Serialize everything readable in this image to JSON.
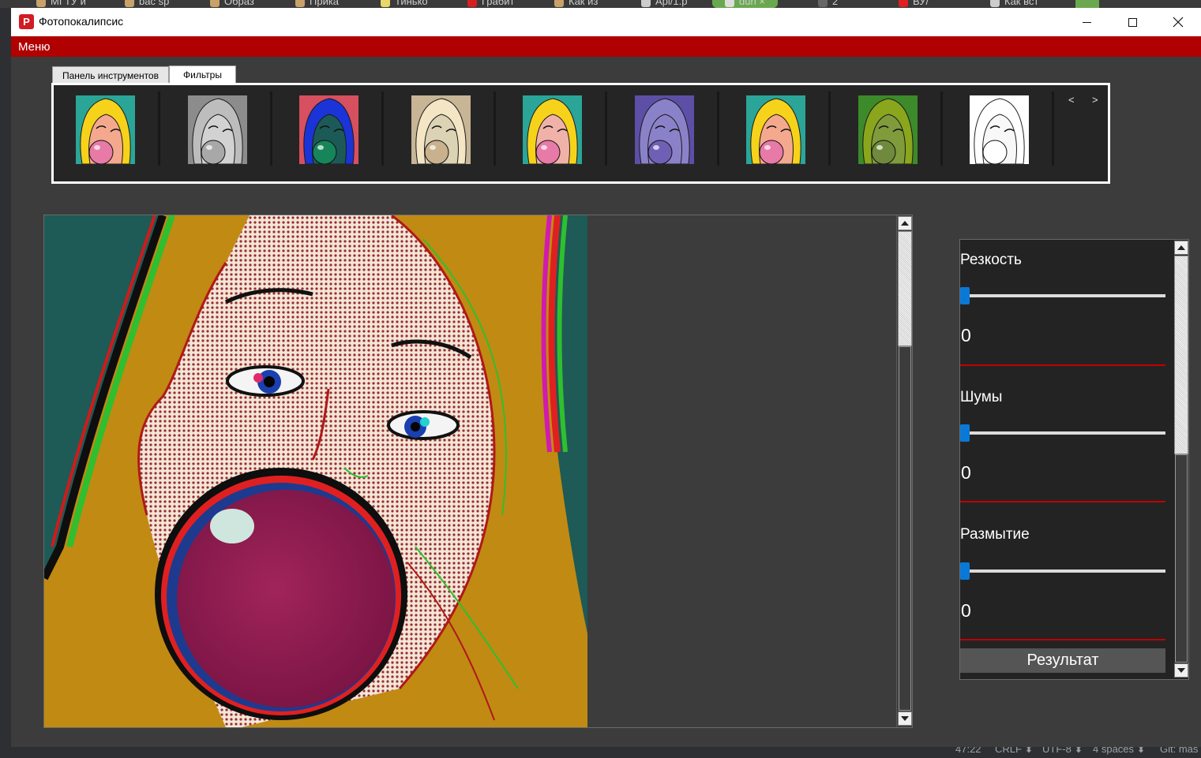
{
  "window": {
    "title": "Фотопокалипсис",
    "icon_letter": "P"
  },
  "menu": {
    "items": [
      {
        "label": "Меню"
      }
    ]
  },
  "tabs": [
    {
      "label": "Панель инструментов",
      "active": false
    },
    {
      "label": "Фильтры",
      "active": true
    }
  ],
  "filters": {
    "items": [
      {
        "name": "original",
        "skin": "#f4a98e",
        "hair": "#f7d21a",
        "bg": "#2aa598",
        "gum": "#e87aa7"
      },
      {
        "name": "grayscale",
        "skin": "#d2d2d2",
        "hair": "#bdbdbd",
        "bg": "#8c8c8c",
        "gum": "#a8a8a8"
      },
      {
        "name": "inverted",
        "skin": "#1c5a57",
        "hair": "#1a34d8",
        "bg": "#d6505f",
        "gum": "#17855a"
      },
      {
        "name": "sepia",
        "skin": "#dcd2b4",
        "hair": "#f4e5c4",
        "bg": "#c7b596",
        "gum": "#c9b18e"
      },
      {
        "name": "halftone",
        "skin": "#f0b2a8",
        "hair": "#f7d21a",
        "bg": "#2aa598",
        "gum": "#e87aa7"
      },
      {
        "name": "purple",
        "skin": "#8a82c9",
        "hair": "#8a82c9",
        "bg": "#5d4fa6",
        "gum": "#6f5fb5"
      },
      {
        "name": "channel-shift",
        "skin": "#f4a98e",
        "hair": "#f7d21a",
        "bg": "#2aa598",
        "gum": "#e87aa7"
      },
      {
        "name": "green-tint",
        "skin": "#7f9b3c",
        "hair": "#8aa61c",
        "bg": "#3c8a2a",
        "gum": "#6f8a3c"
      },
      {
        "name": "sketch",
        "skin": "#f8f8f8",
        "hair": "#ffffff",
        "bg": "#ffffff",
        "gum": "#ffffff"
      }
    ],
    "prev_label": "<",
    "next_label": ">"
  },
  "settings": {
    "sharpness": {
      "label": "Резкость",
      "value": "0"
    },
    "noise": {
      "label": "Шумы",
      "value": "0"
    },
    "blur": {
      "label": "Размытие",
      "value": "0"
    },
    "result_label": "Результат"
  },
  "background": {
    "browser_tabs": [
      "МГТУ и",
      "bac sp",
      "Образ",
      "Прика",
      "Тинько",
      "Грабит",
      "Как из",
      "Api/1.p",
      "dun",
      "2",
      "ВУ/",
      "Как вст"
    ],
    "status": [
      "47:22",
      "CRLF ⬍",
      "UTF-8 ⬍",
      "4 spaces ⬍",
      "Git: mas"
    ]
  },
  "colors": {
    "menubar": "#b00000",
    "accent_slider": "#0a78d7",
    "divider": "#c00000"
  }
}
